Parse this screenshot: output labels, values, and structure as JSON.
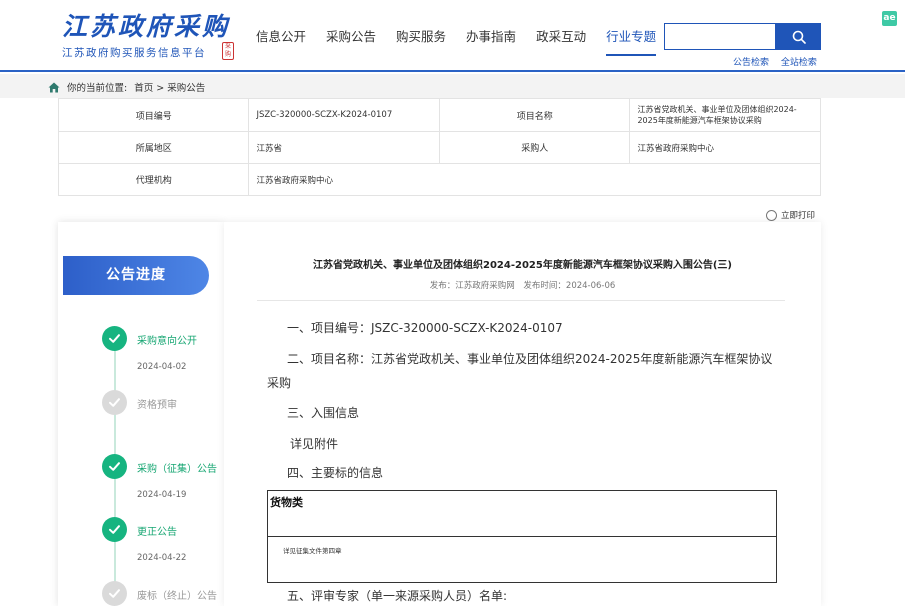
{
  "header": {
    "logo_main": "江苏政府采购",
    "logo_sub": "江苏政府购买服务信息平台",
    "logo_seal": "采购",
    "nav": [
      "信息公开",
      "采购公告",
      "购买服务",
      "办事指南",
      "政采互动",
      "行业专题"
    ],
    "search_placeholder": "",
    "search_links": [
      "公告检索",
      "全站检索"
    ],
    "corner_badge": "ae"
  },
  "breadcrumb": {
    "prefix": "你的当前位置:",
    "path": "首页 > 采购公告"
  },
  "info": {
    "project_no_label": "项目编号",
    "project_no": "JSZC-320000-SCZX-K2024-0107",
    "project_name_label": "项目名称",
    "project_name": "江苏省党政机关、事业单位及团体组织2024-2025年度新能源汽车框架协议采购",
    "region_label": "所属地区",
    "region": "江苏省",
    "purchaser_label": "采购人",
    "purchaser": "江苏省政府采购中心",
    "agency_label": "代理机构",
    "agency": "江苏省政府采购中心"
  },
  "print_label": "立即打印",
  "progress": {
    "title": "公告进度",
    "steps": [
      {
        "label": "采购意向公开",
        "date": "2024-04-02",
        "done": true
      },
      {
        "label": "资格预审",
        "date": "",
        "done": false
      },
      {
        "label": "采购（征集）公告",
        "date": "2024-04-19",
        "done": true
      },
      {
        "label": "更正公告",
        "date": "2024-04-22",
        "done": true
      },
      {
        "label": "废标（终止）公告",
        "date": "",
        "done": false
      }
    ]
  },
  "article": {
    "title": "江苏省党政机关、事业单位及团体组织2024-2025年度新能源汽车框架协议采购入围公告(三)",
    "publisher": "发布：江苏政府采购网",
    "publish_time": "发布时间：2024-06-06",
    "p1": "一、项目编号：JSZC-320000-SCZX-K2024-0107",
    "p2": "二、项目名称：江苏省党政机关、事业单位及团体组织2024-2025年度新能源汽车框架协议采购",
    "p3": "三、入围信息",
    "p3_sub": "详见附件",
    "p4": "四、主要标的信息",
    "goods_head": "货物类",
    "goods_body": "详见征集文件第四章",
    "p5": "五、评审专家（单一来源采购人员）名单:"
  }
}
